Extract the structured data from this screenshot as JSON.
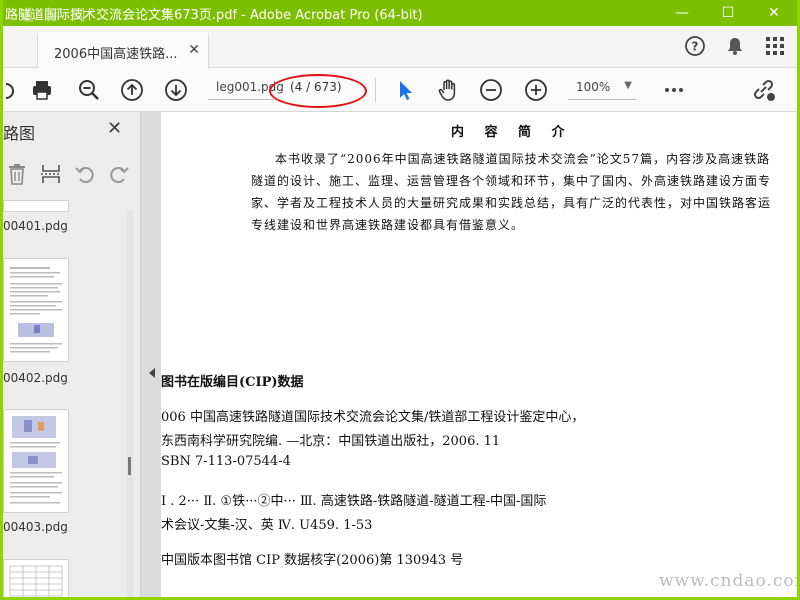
{
  "window": {
    "title": "路隧道国际技术交流会论文集673页.pdf - Adobe Acrobat Pro (64-bit)",
    "watermark": "道 标 网",
    "minimize": "—",
    "maximize": "☐",
    "close": "✕"
  },
  "tab": {
    "label": "2006中国高速铁路...",
    "close": "✕"
  },
  "toolbar": {
    "filename": "leg001.pdg",
    "page_indicator": "(4 / 673)",
    "zoom": "100%"
  },
  "sidepanel": {
    "title": "路图",
    "close": "✕",
    "thumbnails": [
      {
        "label": "00401.pdg"
      },
      {
        "label": "00402.pdg"
      },
      {
        "label": "00403.pdg"
      }
    ]
  },
  "document": {
    "heading": "内 容 简 介",
    "intro": "本书收录了“2006年中国高速铁路隧道国际技术交流会”论文57篇，内容涉及高速铁路隧道的设计、施工、监理、运营管理各个领域和环节，集中了国内、外高速铁路建设方面专家、学者及工程技术人员的大量研究成果和实践总结，具有广泛的代表性，对中国铁路客运专线建设和世界高速铁路建设都具有借鉴意义。",
    "cip_title": "图书在版编目(CIP)数据",
    "cip_lines": [
      "006 中国高速铁路隧道国际技术交流会论文集/铁道部工程设计鉴定中心，",
      "东西南科学研究院编. —北京：中国铁道出版社，2006. 11",
      "SBN 7-113-07544-4",
      "I . 2···   Ⅱ. ①铁···②中···   Ⅲ. 高速铁路-铁路隧道-隧道工程-中国-国际",
      "术会议-文集-汉、英   Ⅳ. U459. 1-53",
      "中国版本图书馆 CIP 数据核字(2006)第 130943 号"
    ]
  },
  "watermark_br": "www.cndao.com",
  "colors": {
    "frame": "#8fd400",
    "accent_blue": "#1a73e8",
    "highlight_red": "#e01010"
  }
}
